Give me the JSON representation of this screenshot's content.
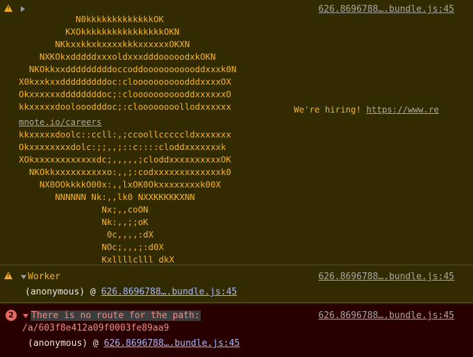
{
  "colors": {
    "warning_bg": "#332b00",
    "error_bg": "#290000",
    "warning_text": "#f7b224",
    "error_text": "#f28b82",
    "link": "#a8b8ff"
  },
  "messages": {
    "banner": {
      "source": "626.8696788….bundle.js:45",
      "ascii_lines": [
        "           N0kkkkkkkkkkkkkOK",
        "         KXOkkkkkkkkkkkkkkkkOKN",
        "       NKkxxkkxkxxxxkkkxxxxxxOKXN",
        "    NXKOkxdddddxxxoldxxxdddooooodxkOKN",
        "  NKOkkxxdddddddddoccoddooooooooooddxxxk0N",
        "X0kxxkxxdddddddddoc:cloooooooooodddxxxxOX",
        "Okxxxxxxddddddddoc;:clooooooooooddxxxxxxO",
        "kkxxxxxdoolooodddoc;:cloooooooollodxxxxxx"
      ],
      "hiring_text": "We're hiring! ",
      "hiring_link": "https://www.re",
      "careers_link": "mnote.io/careers",
      "ascii_lines_after": [
        "kkxxxxxdoolc::ccll:,;ccoollcccccldxxxxxxx",
        "Okxxxxxxxxdolc:;;,,;::c::::cloddxxxxxxxk",
        "XOkxxxxxxxxxxxxdc;,,,,,;cloddxxxxxxxxxxOK",
        "  NKOkkxxxxxxxxxxo:,,;:codxxxxxxxxxxxxxk0",
        "    NX0OOkkkkO00x:,,lxOK0Okxxxxxxxxk00X",
        "       NNNNNN Nk:,,lk0 NXXKKKKKXNN",
        "                Nx;,,coON",
        "                Nk:,,;;oK",
        "                 0c,,,,:dX",
        "                NOc;,,,;:d0X",
        "                Kxllllclll dkX"
      ]
    },
    "worker": {
      "label": "Worker",
      "source": "626.8696788….bundle.js:45",
      "stack_prefix": "(anonymous) @ ",
      "stack_link": "626.8696788….bundle.js:45"
    },
    "error": {
      "count": "2",
      "text": "There is no route for the path:",
      "path": "/a/603f8e412a09f0003fe89aa9",
      "source": "626.8696788….bundle.js:45",
      "stack_prefix": "(anonymous) @ ",
      "stack_link": "626.8696788….bundle.js:45"
    }
  }
}
